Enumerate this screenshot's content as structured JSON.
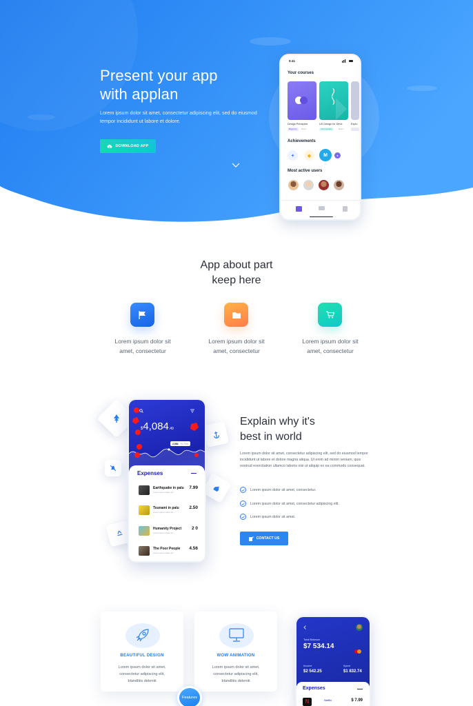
{
  "hero": {
    "title_line1": "Present your app",
    "title_line2": "with applan",
    "description": "Lorem ipsum dolor sit amet, consectetur adipiscing elit, sed do eiusmod tempor incididunt ut labore et dolore.",
    "download_label": "DOWNLOAD APP"
  },
  "phone1": {
    "time": "9:41",
    "courses_heading": "Your courses",
    "courses": [
      {
        "name": "Design Principles",
        "tag": "Beginner",
        "tag2": "Basic",
        "color": "#7c6bf0"
      },
      {
        "name": "UX Design for Devs",
        "tag": "Intermediate",
        "tag2": "Basic",
        "color": "#21c9b8"
      },
      {
        "name": "Explo",
        "tag": "",
        "tag2": "",
        "color": "#c9cbe0"
      }
    ],
    "achievements_heading": "Achievements",
    "active_users_heading": "Most active users"
  },
  "about": {
    "title_line1": "App about part",
    "title_line2": "keep here",
    "features": [
      {
        "text_line1": "Lorem ipsum dolor sit",
        "text_line2": "amet, consectetur",
        "icon": "flag-icon",
        "color_from": "#3a8cff",
        "color_to": "#1463e6"
      },
      {
        "text_line1": "Lorem ipsum dolor sit",
        "text_line2": "amet, consectetur",
        "icon": "folder-icon",
        "color_from": "#ffb347",
        "color_to": "#ff7b4a"
      },
      {
        "text_line1": "Lorem ipsum dolor sit",
        "text_line2": "amet, consectetur",
        "icon": "cart-icon",
        "color_from": "#1fe0b0",
        "color_to": "#12c8c8"
      }
    ]
  },
  "explain": {
    "title_line1": "Explain why it's",
    "title_line2": "best in world",
    "paragraph": "Lorem ipsum dolor sit amet, consectetur adipiscing elit, sed do eiusmod tempor incididunt ut labore et dolore magna aliqua. Ut enim ad minim veniam, quis nostrud exercitation ullamco laboris nisi ut aliquip ex ea commodo consequat.",
    "checks": [
      "Lorem ipsum dolor sit amet, consectetur.",
      "Lorem ipsum dolor sit amet, consectetur adipiscing elit.",
      "Lorem ipsum dolor sit amet."
    ],
    "contact_label": "CONTACT US"
  },
  "phone2": {
    "amount_prefix": "$",
    "amount": "4,084",
    "amount_cents": ".49",
    "chip1": "2,084",
    "chip2": "Tu, Feb",
    "expenses_heading": "Expenses",
    "rows": [
      {
        "name": "Earthquake in palu",
        "sub": "Lorem ipsum dolor sit ...",
        "amount": "7.99",
        "thumb": "#3a3a3a"
      },
      {
        "name": "Tsunami in palu",
        "sub": "Lorem ipsum dolor sit ...",
        "amount": "2.50",
        "thumb": "#e8c62a"
      },
      {
        "name": "Humanity Project",
        "sub": "Lorem ipsum dolor sit ...",
        "amount": "2 0",
        "thumb": "#3fa0c8"
      },
      {
        "name": "The Poor People",
        "sub": "Lorem ipsum dolor sit ...",
        "amount": "4.56",
        "thumb": "#6b5a4a"
      }
    ]
  },
  "cards": [
    {
      "title": "BEAUTIFUL DESIGN",
      "line1": "Lorem ipsum dolor sit amet,",
      "line2": "consectetur adipiscing elit,",
      "line3": "blanditiis deleniti",
      "icon": "rocket-icon"
    },
    {
      "title": "WOW ANIMATION",
      "line1": "Lorem ipsum dolor sit amet,",
      "line2": "consectetur adipiscing elit,",
      "line3": "blanditiis deleniti",
      "icon": "monitor-icon"
    }
  ],
  "features_badge": "Features",
  "phone3": {
    "balance_label": "Total Balance",
    "balance": "$7 534.14",
    "income_label": "Income",
    "income": "$2 542.25",
    "spent_label": "Spent",
    "spent": "$1 832.74",
    "expenses_heading": "Expenses",
    "row_name": "Netflix",
    "row_amount": "$ 7.99"
  }
}
